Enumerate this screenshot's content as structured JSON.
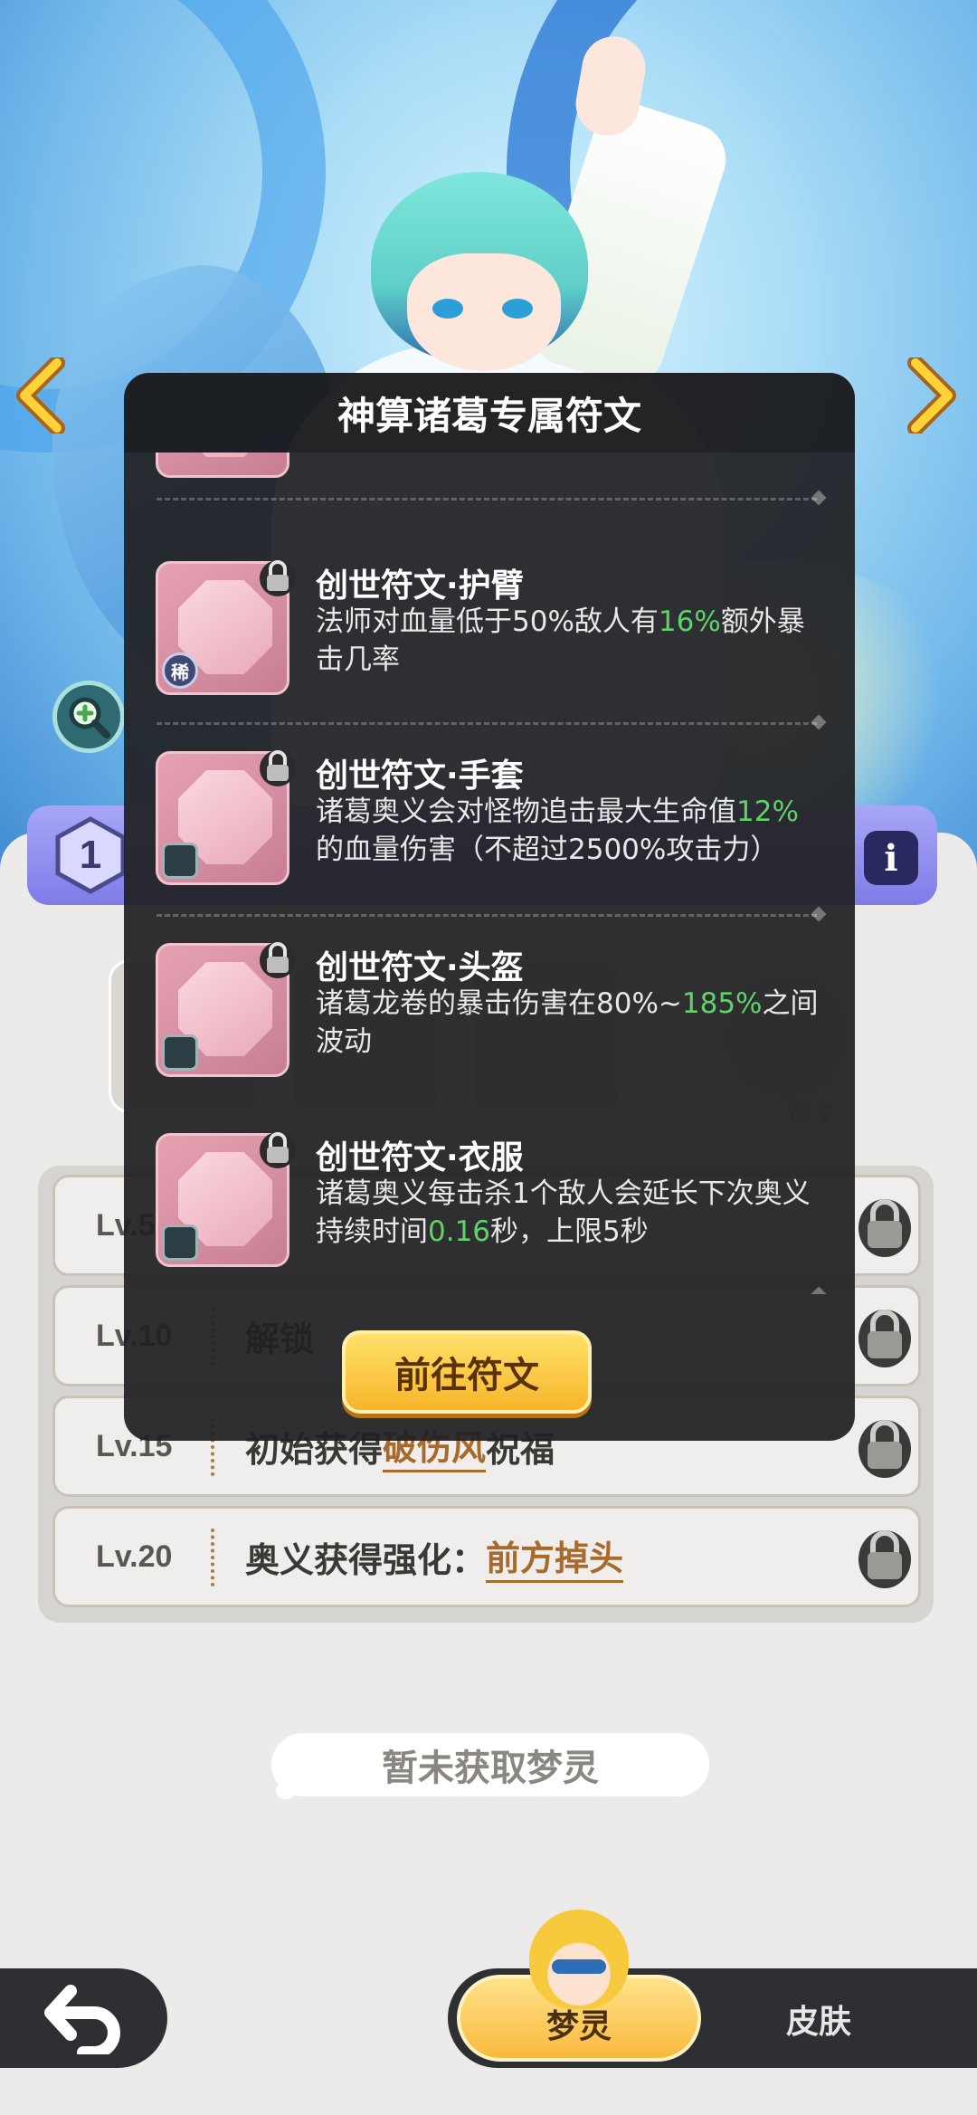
{
  "modal": {
    "title": "神算诸葛专属符文",
    "partial_tag": "稀",
    "runes": [
      {
        "name": "创世符文·护臂",
        "desc_parts": [
          "法师对血量低于50%敌人有",
          "16%",
          "额外暴击几率"
        ],
        "tag": "稀"
      },
      {
        "name": "创世符文·手套",
        "desc_parts": [
          "诸葛奥义会对怪物追击最大生命值",
          "12%",
          "的血量伤害（不超过2500%攻击力）"
        ],
        "tag": "face"
      },
      {
        "name": "创世符文·头盔",
        "desc_parts": [
          "诸葛龙卷的暴击伤害在80%~",
          "185%",
          "之间波动"
        ],
        "tag": "face"
      },
      {
        "name": "创世符文·衣服",
        "desc_parts": [
          "诸葛奥义每击杀1个敌人会延长下次奥义持续时间",
          "0.16",
          "秒，上限5秒"
        ],
        "tag": "face"
      }
    ],
    "goto_button": "前往符文",
    "highlight_color": "#5fd36a"
  },
  "level_badge": "1",
  "info_icon": "i",
  "slot_label": "符文",
  "skills": [
    {
      "level": "Lv.5",
      "text": "",
      "highlight": ""
    },
    {
      "level": "Lv.10",
      "text": "解锁",
      "highlight": ""
    },
    {
      "level": "Lv.15",
      "text": "初始获得",
      "highlight": "破伤风",
      "suffix": "祝福"
    },
    {
      "level": "Lv.20",
      "text": "奥义获得强化：",
      "highlight": "前方掉头",
      "suffix": ""
    }
  ],
  "notice": "暂未获取梦灵",
  "tabs": {
    "active": "梦灵",
    "inactive": "皮肤"
  },
  "icons": {
    "nav_left": "chevron-left-icon",
    "nav_right": "chevron-right-icon",
    "zoom": "zoom-in-icon",
    "lock": "lock-icon",
    "back": "back-arrow-icon"
  }
}
